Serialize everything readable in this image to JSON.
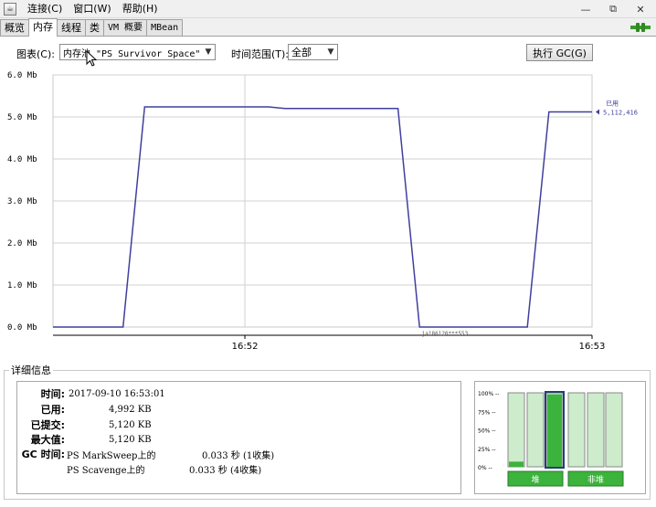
{
  "menu": {
    "items": [
      "连接(C)",
      "窗口(W)",
      "帮助(H)"
    ]
  },
  "window_controls": {
    "minimize": "—",
    "restore": "⧉",
    "close": "✕"
  },
  "tabs": [
    {
      "label": "概览",
      "active": false
    },
    {
      "label": "内存",
      "active": true
    },
    {
      "label": "线程",
      "active": false
    },
    {
      "label": "类",
      "active": false
    },
    {
      "label": "VM 概要",
      "active": false
    },
    {
      "label": "MBean",
      "active": false
    }
  ],
  "controls": {
    "chart_label": "图表(C):",
    "chart_value": "内存池 \"PS Survivor Space\"",
    "range_label": "时间范围(T):",
    "range_value": "全部",
    "gc_button": "执行 GC(G)"
  },
  "chart_data": {
    "type": "line",
    "title": "",
    "xlabel": "",
    "ylabel": "",
    "y_ticks": [
      "0.0 Mb",
      "1.0 Mb",
      "2.0 Mb",
      "3.0 Mb",
      "4.0 Mb",
      "5.0 Mb",
      "6.0 Mb"
    ],
    "x_ticks": [
      "16:52",
      "16:53"
    ],
    "ylim": [
      0,
      6.0
    ],
    "grid": true,
    "host_label": "ja186120***553",
    "series": [
      {
        "name": "已用",
        "color": "#3f3f9f",
        "x": [
          0,
          0.13,
          0.17,
          0.4,
          0.43,
          0.64,
          0.68,
          0.88,
          0.92,
          1.0
        ],
        "y": [
          0,
          0,
          5.24,
          5.24,
          5.2,
          5.2,
          0,
          0,
          5.12,
          5.12
        ]
      }
    ],
    "current_value_label": "已用",
    "current_value": "5,112,416"
  },
  "details": {
    "title": "详细信息",
    "time_label": "时间:",
    "time_value": "2017-09-10 16:53:01",
    "used_label": "已用:",
    "used_value": "4,992 KB",
    "committed_label": "已提交:",
    "committed_value": "5,120 KB",
    "max_label": "最大值:",
    "max_value": "5,120 KB",
    "gc_label": "GC 时间:",
    "gc1_name": "PS MarkSweep上的",
    "gc1_time": "0.033 秒 (1收集)",
    "gc2_name": "PS Scavenge上的",
    "gc2_time": "0.033 秒 (4收集)"
  },
  "pools": {
    "ticks": [
      "100%",
      "75%",
      "50%",
      "25%",
      "0%"
    ],
    "heap_label": "堆",
    "nonheap_label": "非堆",
    "heap_bars": [
      0.07,
      0.0,
      0.98
    ],
    "nonheap_bars": [
      0.0,
      0.0,
      0.0
    ],
    "selected_index": 2
  }
}
